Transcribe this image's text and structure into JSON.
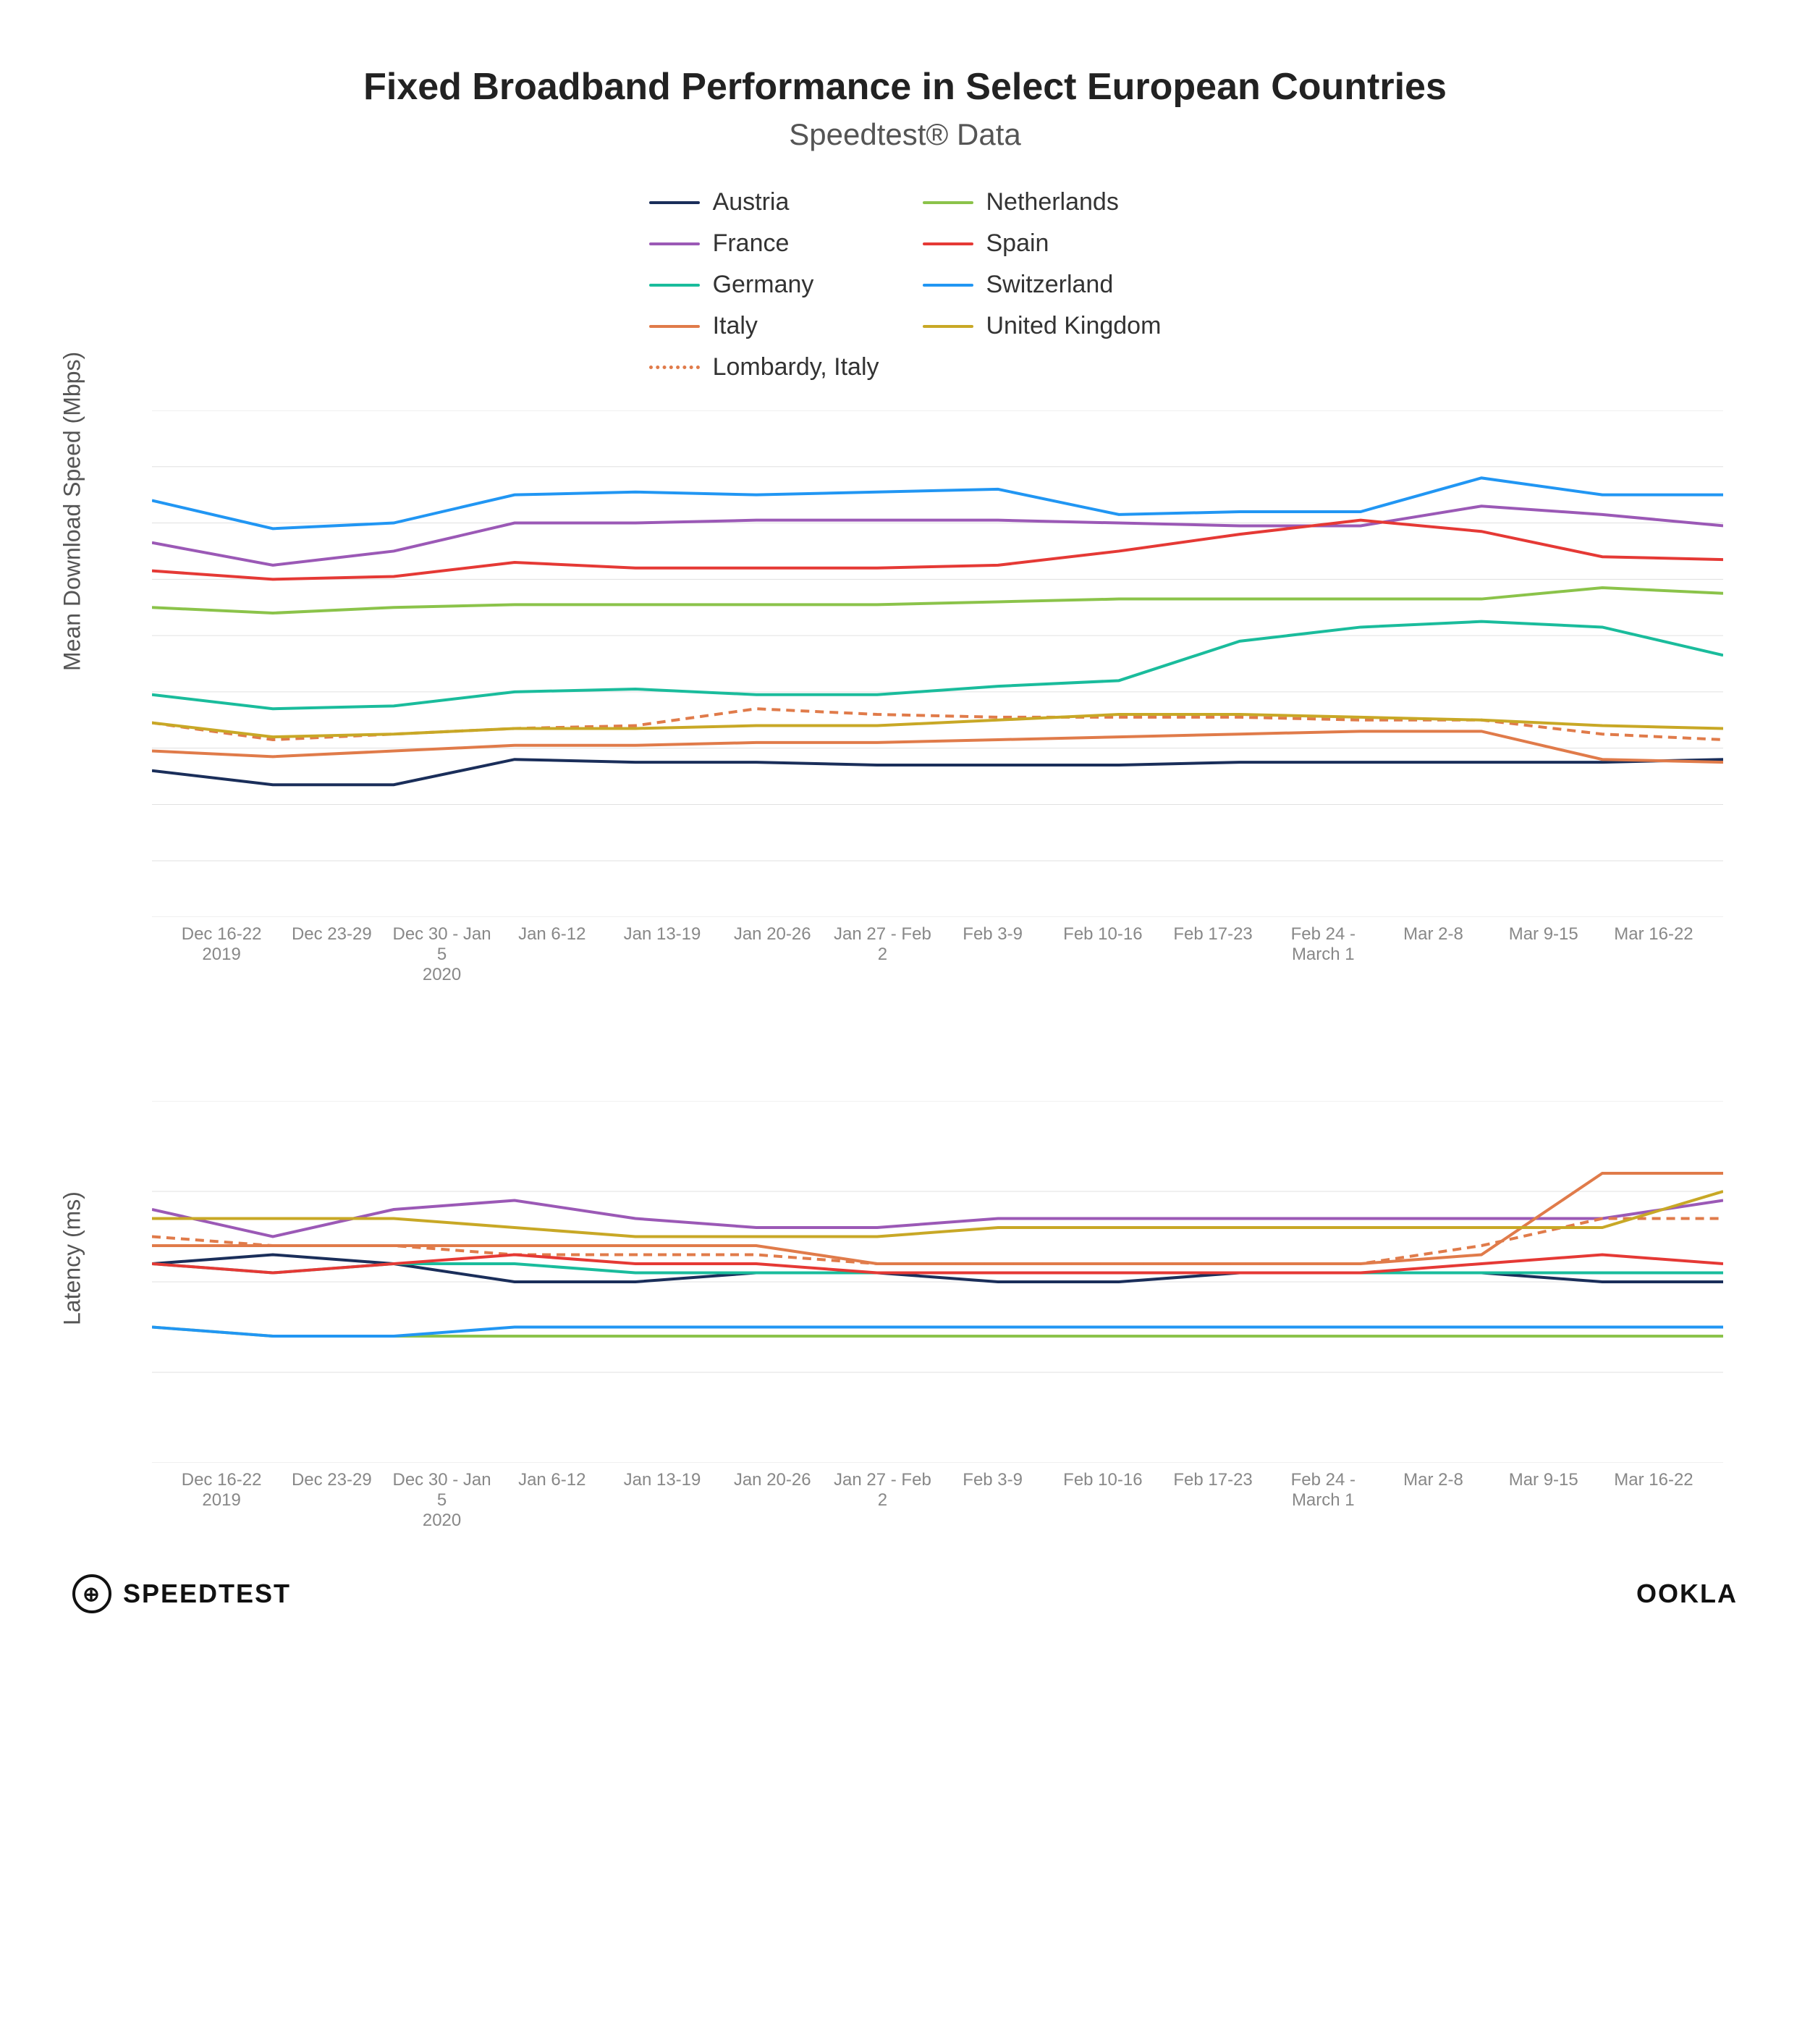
{
  "title": "Fixed Broadband Performance in Select European Countries",
  "subtitle": "Speedtest® Data",
  "legend": {
    "col1": [
      {
        "label": "Austria",
        "color": "#1a2e5a",
        "dash": false
      },
      {
        "label": "France",
        "color": "#9b59b6",
        "dash": false
      },
      {
        "label": "Germany",
        "color": "#1abc9c",
        "dash": false
      },
      {
        "label": "Italy",
        "color": "#e07b4a",
        "dash": false
      },
      {
        "label": "Lombardy, Italy",
        "color": "#e07b4a",
        "dash": true
      }
    ],
    "col2": [
      {
        "label": "Netherlands",
        "color": "#8bc34a",
        "dash": false
      },
      {
        "label": "Spain",
        "color": "#e53935",
        "dash": false
      },
      {
        "label": "Switzerland",
        "color": "#2196f3",
        "dash": false
      },
      {
        "label": "United Kingdom",
        "color": "#c8a826",
        "dash": false
      }
    ]
  },
  "xLabels": [
    "Dec 16-22\n2019",
    "Dec 23-29",
    "Dec 30 - Jan 5\n2020",
    "Jan 6-12",
    "Jan 13-19",
    "Jan 20-26",
    "Jan 27 - Feb 2",
    "Feb 3-9",
    "Feb 10-16",
    "Feb 17-23",
    "Feb 24 - March 1",
    "Mar 2-8",
    "Mar 9-15",
    "Mar 16-22"
  ],
  "downloadChart": {
    "yAxisLabel": "Mean Download Speed (Mbps)",
    "yMin": 0,
    "yMax": 180,
    "yTicks": [
      0,
      20,
      40,
      60,
      80,
      100,
      120,
      140,
      160,
      180
    ],
    "series": {
      "Austria": {
        "color": "#1a2e5a",
        "dash": false,
        "values": [
          52,
          47,
          47,
          56,
          55,
          55,
          54,
          54,
          54,
          55,
          55,
          55,
          55,
          56
        ]
      },
      "France": {
        "color": "#9b59b6",
        "dash": false,
        "values": [
          133,
          125,
          130,
          140,
          140,
          141,
          141,
          141,
          140,
          139,
          139,
          146,
          143,
          139
        ]
      },
      "Germany": {
        "color": "#1abc9c",
        "dash": false,
        "values": [
          79,
          74,
          75,
          80,
          81,
          79,
          79,
          82,
          84,
          98,
          103,
          105,
          103,
          93
        ]
      },
      "Italy": {
        "color": "#e07b4a",
        "dash": false,
        "values": [
          59,
          57,
          59,
          61,
          61,
          62,
          62,
          63,
          64,
          65,
          66,
          66,
          56,
          55
        ]
      },
      "Lombardy": {
        "color": "#e07b4a",
        "dash": true,
        "values": [
          69,
          63,
          65,
          67,
          68,
          74,
          72,
          71,
          71,
          71,
          70,
          70,
          65,
          63
        ]
      },
      "Netherlands": {
        "color": "#8bc34a",
        "dash": false,
        "values": [
          110,
          108,
          110,
          111,
          111,
          111,
          111,
          112,
          113,
          113,
          113,
          113,
          117,
          115
        ]
      },
      "Spain": {
        "color": "#e53935",
        "dash": false,
        "values": [
          123,
          120,
          121,
          126,
          124,
          124,
          124,
          125,
          130,
          136,
          141,
          137,
          128,
          127
        ]
      },
      "Switzerland": {
        "color": "#2196f3",
        "dash": false,
        "values": [
          148,
          138,
          140,
          150,
          151,
          150,
          151,
          152,
          143,
          144,
          144,
          156,
          150,
          150
        ]
      },
      "UnitedKingdom": {
        "color": "#c8a826",
        "dash": false,
        "values": [
          69,
          64,
          65,
          67,
          67,
          68,
          68,
          70,
          72,
          72,
          71,
          70,
          68,
          67
        ]
      }
    }
  },
  "latencyChart": {
    "yAxisLabel": "Latency (ms)",
    "yMin": 0,
    "yMax": 40,
    "yTicks": [
      0,
      10,
      20,
      30,
      40
    ],
    "series": {
      "Austria": {
        "color": "#1a2e5a",
        "dash": false,
        "values": [
          22,
          23,
          22,
          20,
          20,
          21,
          21,
          20,
          20,
          21,
          21,
          21,
          20,
          20
        ]
      },
      "France": {
        "color": "#9b59b6",
        "dash": false,
        "values": [
          28,
          25,
          28,
          29,
          27,
          26,
          26,
          27,
          27,
          27,
          27,
          27,
          27,
          29
        ]
      },
      "Germany": {
        "color": "#1abc9c",
        "dash": false,
        "values": [
          22,
          21,
          22,
          22,
          21,
          21,
          21,
          21,
          21,
          21,
          21,
          21,
          21,
          21
        ]
      },
      "Italy": {
        "color": "#e07b4a",
        "dash": false,
        "values": [
          24,
          24,
          24,
          24,
          24,
          24,
          22,
          22,
          22,
          22,
          22,
          23,
          32,
          32
        ]
      },
      "Lombardy": {
        "color": "#e07b4a",
        "dash": true,
        "values": [
          25,
          24,
          24,
          23,
          23,
          23,
          22,
          22,
          22,
          22,
          22,
          24,
          27,
          27
        ]
      },
      "Netherlands": {
        "color": "#8bc34a",
        "dash": false,
        "values": [
          15,
          14,
          14,
          14,
          14,
          14,
          14,
          14,
          14,
          14,
          14,
          14,
          14,
          14
        ]
      },
      "Spain": {
        "color": "#e53935",
        "dash": false,
        "values": [
          22,
          21,
          22,
          23,
          22,
          22,
          21,
          21,
          21,
          21,
          21,
          22,
          23,
          22
        ]
      },
      "Switzerland": {
        "color": "#2196f3",
        "dash": false,
        "values": [
          15,
          14,
          14,
          15,
          15,
          15,
          15,
          15,
          15,
          15,
          15,
          15,
          15,
          15
        ]
      },
      "UnitedKingdom": {
        "color": "#c8a826",
        "dash": false,
        "values": [
          27,
          27,
          27,
          26,
          25,
          25,
          25,
          26,
          26,
          26,
          26,
          26,
          26,
          30
        ]
      }
    }
  },
  "footer": {
    "speedtest": "SPEEDTEST",
    "ookla": "OOKLA"
  }
}
